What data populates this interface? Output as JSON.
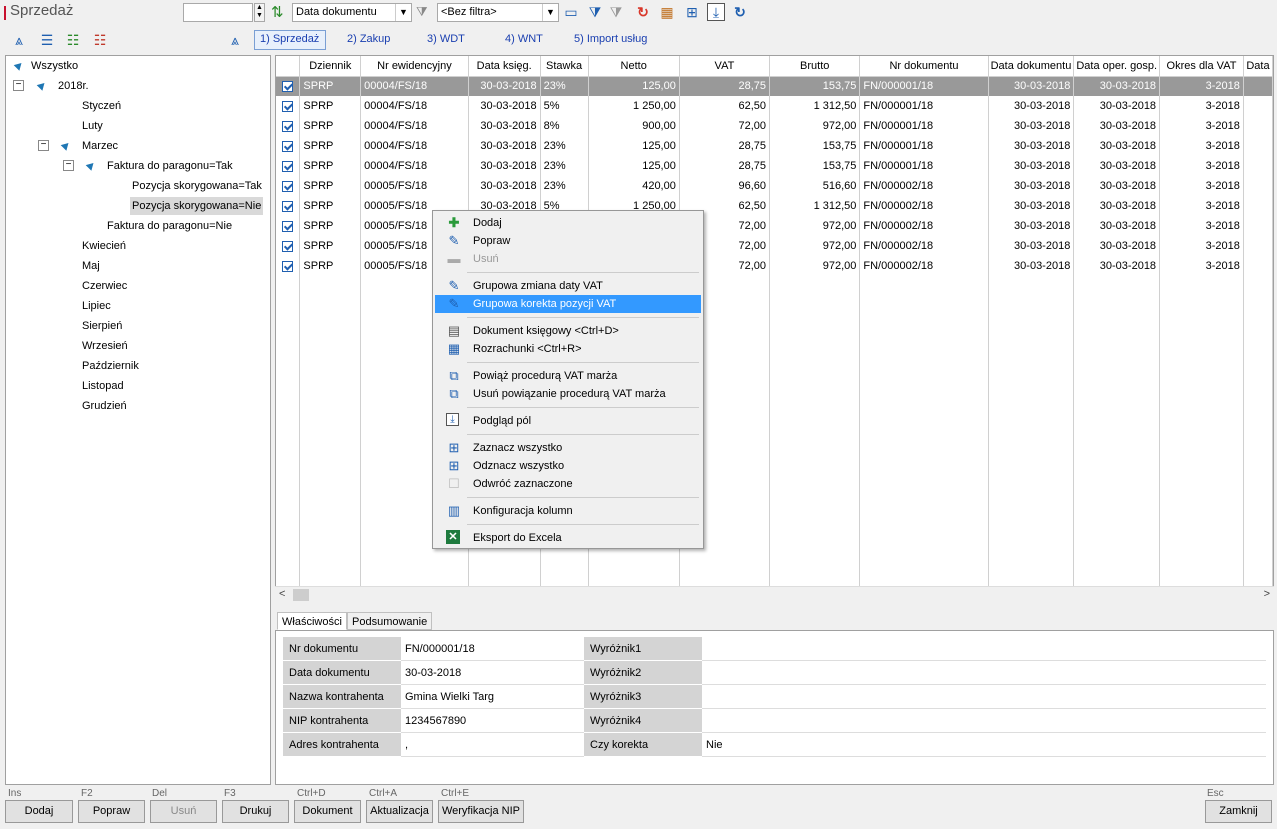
{
  "window": {
    "title": "Sprzedaż"
  },
  "toolbar": {
    "sort_field": "Data dokumentu",
    "filter": "<Bez filtra>"
  },
  "tabs": [
    {
      "label": "1) Sprzedaż"
    },
    {
      "label": "2) Zakup"
    },
    {
      "label": "3) WDT"
    },
    {
      "label": "4) WNT"
    },
    {
      "label": "5) Import usług"
    }
  ],
  "tree": {
    "root": "Wszystko",
    "year": "2018r.",
    "months": [
      "Styczeń",
      "Luty",
      "Marzec",
      "Kwiecień",
      "Maj",
      "Czerwiec",
      "Lipiec",
      "Sierpień",
      "Wrzesień",
      "Październik",
      "Listopad",
      "Grudzień"
    ],
    "node1": "Faktura do paragonu=Tak",
    "node1a": "Pozycja skorygowana=Tak",
    "node1b": "Pozycja skorygowana=Nie",
    "node2": "Faktura do paragonu=Nie"
  },
  "grid": {
    "columns": [
      "Dziennik",
      "Nr ewidencyjny",
      "Data księg.",
      "Stawka",
      "Netto",
      "VAT",
      "Brutto",
      "Nr dokumentu",
      "Data dokumentu",
      "Data oper. gosp.",
      "Okres dla VAT",
      "Data"
    ],
    "rows": [
      [
        "SPRP",
        "00004/FS/18",
        "30-03-2018",
        "23%",
        "125,00",
        "28,75",
        "153,75",
        "FN/000001/18",
        "30-03-2018",
        "30-03-2018",
        "3-2018"
      ],
      [
        "SPRP",
        "00004/FS/18",
        "30-03-2018",
        "5%",
        "1 250,00",
        "62,50",
        "1 312,50",
        "FN/000001/18",
        "30-03-2018",
        "30-03-2018",
        "3-2018"
      ],
      [
        "SPRP",
        "00004/FS/18",
        "30-03-2018",
        "8%",
        "900,00",
        "72,00",
        "972,00",
        "FN/000001/18",
        "30-03-2018",
        "30-03-2018",
        "3-2018"
      ],
      [
        "SPRP",
        "00004/FS/18",
        "30-03-2018",
        "23%",
        "125,00",
        "28,75",
        "153,75",
        "FN/000001/18",
        "30-03-2018",
        "30-03-2018",
        "3-2018"
      ],
      [
        "SPRP",
        "00004/FS/18",
        "30-03-2018",
        "23%",
        "125,00",
        "28,75",
        "153,75",
        "FN/000001/18",
        "30-03-2018",
        "30-03-2018",
        "3-2018"
      ],
      [
        "SPRP",
        "00005/FS/18",
        "30-03-2018",
        "23%",
        "420,00",
        "96,60",
        "516,60",
        "FN/000002/18",
        "30-03-2018",
        "30-03-2018",
        "3-2018"
      ],
      [
        "SPRP",
        "00005/FS/18",
        "30-03-2018",
        "5%",
        "1 250,00",
        "62,50",
        "1 312,50",
        "FN/000002/18",
        "30-03-2018",
        "30-03-2018",
        "3-2018"
      ],
      [
        "SPRP",
        "00005/FS/18",
        "",
        "",
        "",
        "72,00",
        "972,00",
        "FN/000002/18",
        "30-03-2018",
        "30-03-2018",
        "3-2018"
      ],
      [
        "SPRP",
        "00005/FS/18",
        "",
        "",
        "",
        "72,00",
        "972,00",
        "FN/000002/18",
        "30-03-2018",
        "30-03-2018",
        "3-2018"
      ],
      [
        "SPRP",
        "00005/FS/18",
        "",
        "",
        "",
        "72,00",
        "972,00",
        "FN/000002/18",
        "30-03-2018",
        "30-03-2018",
        "3-2018"
      ]
    ]
  },
  "context_menu": {
    "items": [
      "Dodaj",
      "Popraw",
      "Usuń",
      "Grupowa zmiana daty VAT",
      "Grupowa korekta pozycji VAT",
      "Dokument księgowy <Ctrl+D>",
      "Rozrachunki <Ctrl+R>",
      "Powiąż procedurą VAT marża",
      "Usuń powiązanie procedurą VAT marża",
      "Podgląd pól",
      "Zaznacz wszystko",
      "Odznacz wszystko",
      "Odwróć zaznaczone",
      "Konfiguracja kolumn",
      "Eksport do Excela"
    ]
  },
  "props": {
    "tabs": [
      "Właściwości",
      "Podsumowanie"
    ],
    "left": [
      [
        "Nr dokumentu",
        "FN/000001/18"
      ],
      [
        "Data dokumentu",
        "30-03-2018"
      ],
      [
        "Nazwa kontrahenta",
        "Gmina Wielki Targ"
      ],
      [
        "NIP kontrahenta",
        "1234567890"
      ],
      [
        "Adres kontrahenta",
        ","
      ]
    ],
    "right": [
      [
        "Wyróżnik1",
        ""
      ],
      [
        "Wyróżnik2",
        ""
      ],
      [
        "Wyróżnik3",
        ""
      ],
      [
        "Wyróżnik4",
        ""
      ],
      [
        "Czy korekta",
        "Nie"
      ]
    ]
  },
  "footer": {
    "keys": [
      "Ins",
      "F2",
      "Del",
      "F3",
      "Ctrl+D",
      "Ctrl+A",
      "Ctrl+E",
      "Esc"
    ],
    "buttons": [
      "Dodaj",
      "Popraw",
      "Usuń",
      "Drukuj",
      "Dokument",
      "Aktualizacja",
      "Weryfikacja NIP",
      "Zamknij"
    ]
  }
}
